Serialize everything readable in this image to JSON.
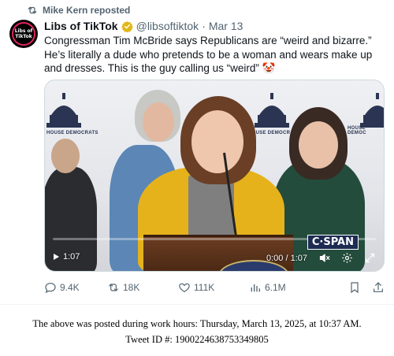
{
  "repost": {
    "label": "Mike Kern reposted"
  },
  "author": {
    "avatar_text": "Libs of TikTok",
    "display_name": "Libs of TikTok",
    "handle": "@libsoftiktok",
    "separator": "·",
    "date": "Mar 13"
  },
  "tweet": {
    "text": "Congressman Tim McBride says Republicans are “weird and bizarre.” He’s literally a dude who pretends to be a woman and wears make up and dresses. This is the guy calling us “weird” 🤡"
  },
  "video": {
    "banner_left": "HOUSE DEMOCRATS",
    "banner_mid": "HOUSE DEMOCRATS",
    "banner_right": "HOUSE DEMOC",
    "corner_duration": "1:07",
    "time_display": "0:00 / 1:07",
    "network_badge": "C·SPAN",
    "progress": 0
  },
  "actions": {
    "replies": "9.4K",
    "reposts": "18K",
    "likes": "111K",
    "views": "6.1M"
  },
  "caption": {
    "line1": "The above was posted during work hours: Thursday, March 13, 2025, at 10:37 AM.",
    "line2": "Tweet ID #: 1900224638753349805"
  },
  "colors": {
    "accent": "#1d9bf0",
    "verified_gold": "#e2b719",
    "muted_text": "#536471"
  }
}
